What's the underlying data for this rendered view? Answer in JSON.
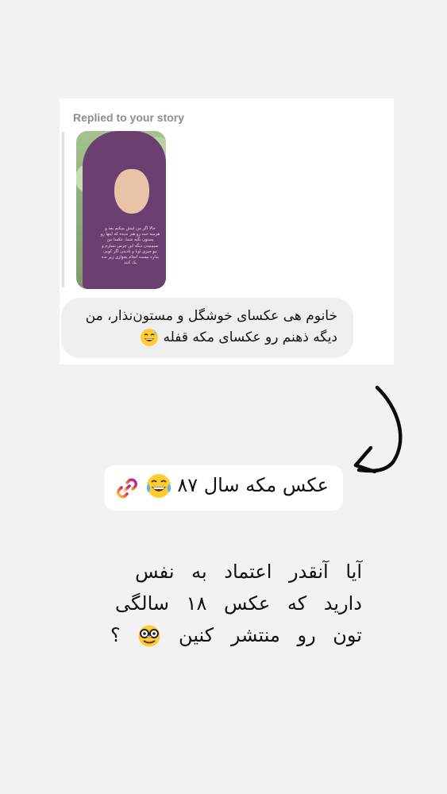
{
  "reply_card": {
    "label": "Replied to your story",
    "story_overlay_text": "حالا اگر من اینش میکنم بعد و هرمیه حت رو هنز ندیده که اینها رو پستون بگیه شما، عکسا من نمیبینیدن دیگه این چرس نمیارم و مو جیزی اونا و نادیدن اگر کونی یداره نیست انجام یجوازی زیر نده یک کنند",
    "message": "خانوم هی عکسای خوشگل و مستون‌نذار، من دیگه ذهنم رو عکسای مکه قفله",
    "message_emoji": "sweat-smile-emoji"
  },
  "arrow_icon": "hand-drawn-curved-arrow-icon",
  "link_sticker": {
    "text": "عکس مکه سال ۸۷",
    "emoji": "tears-of-joy-emoji",
    "icon": "link-icon",
    "accent": "#d62976"
  },
  "question": {
    "text": "آیا آنقدر اعتماد به نفس دارید که عکس ۱۸ سالگی تون رو منتشر کنین",
    "trailing": "؟",
    "emoji": "disguised-face-emoji"
  }
}
